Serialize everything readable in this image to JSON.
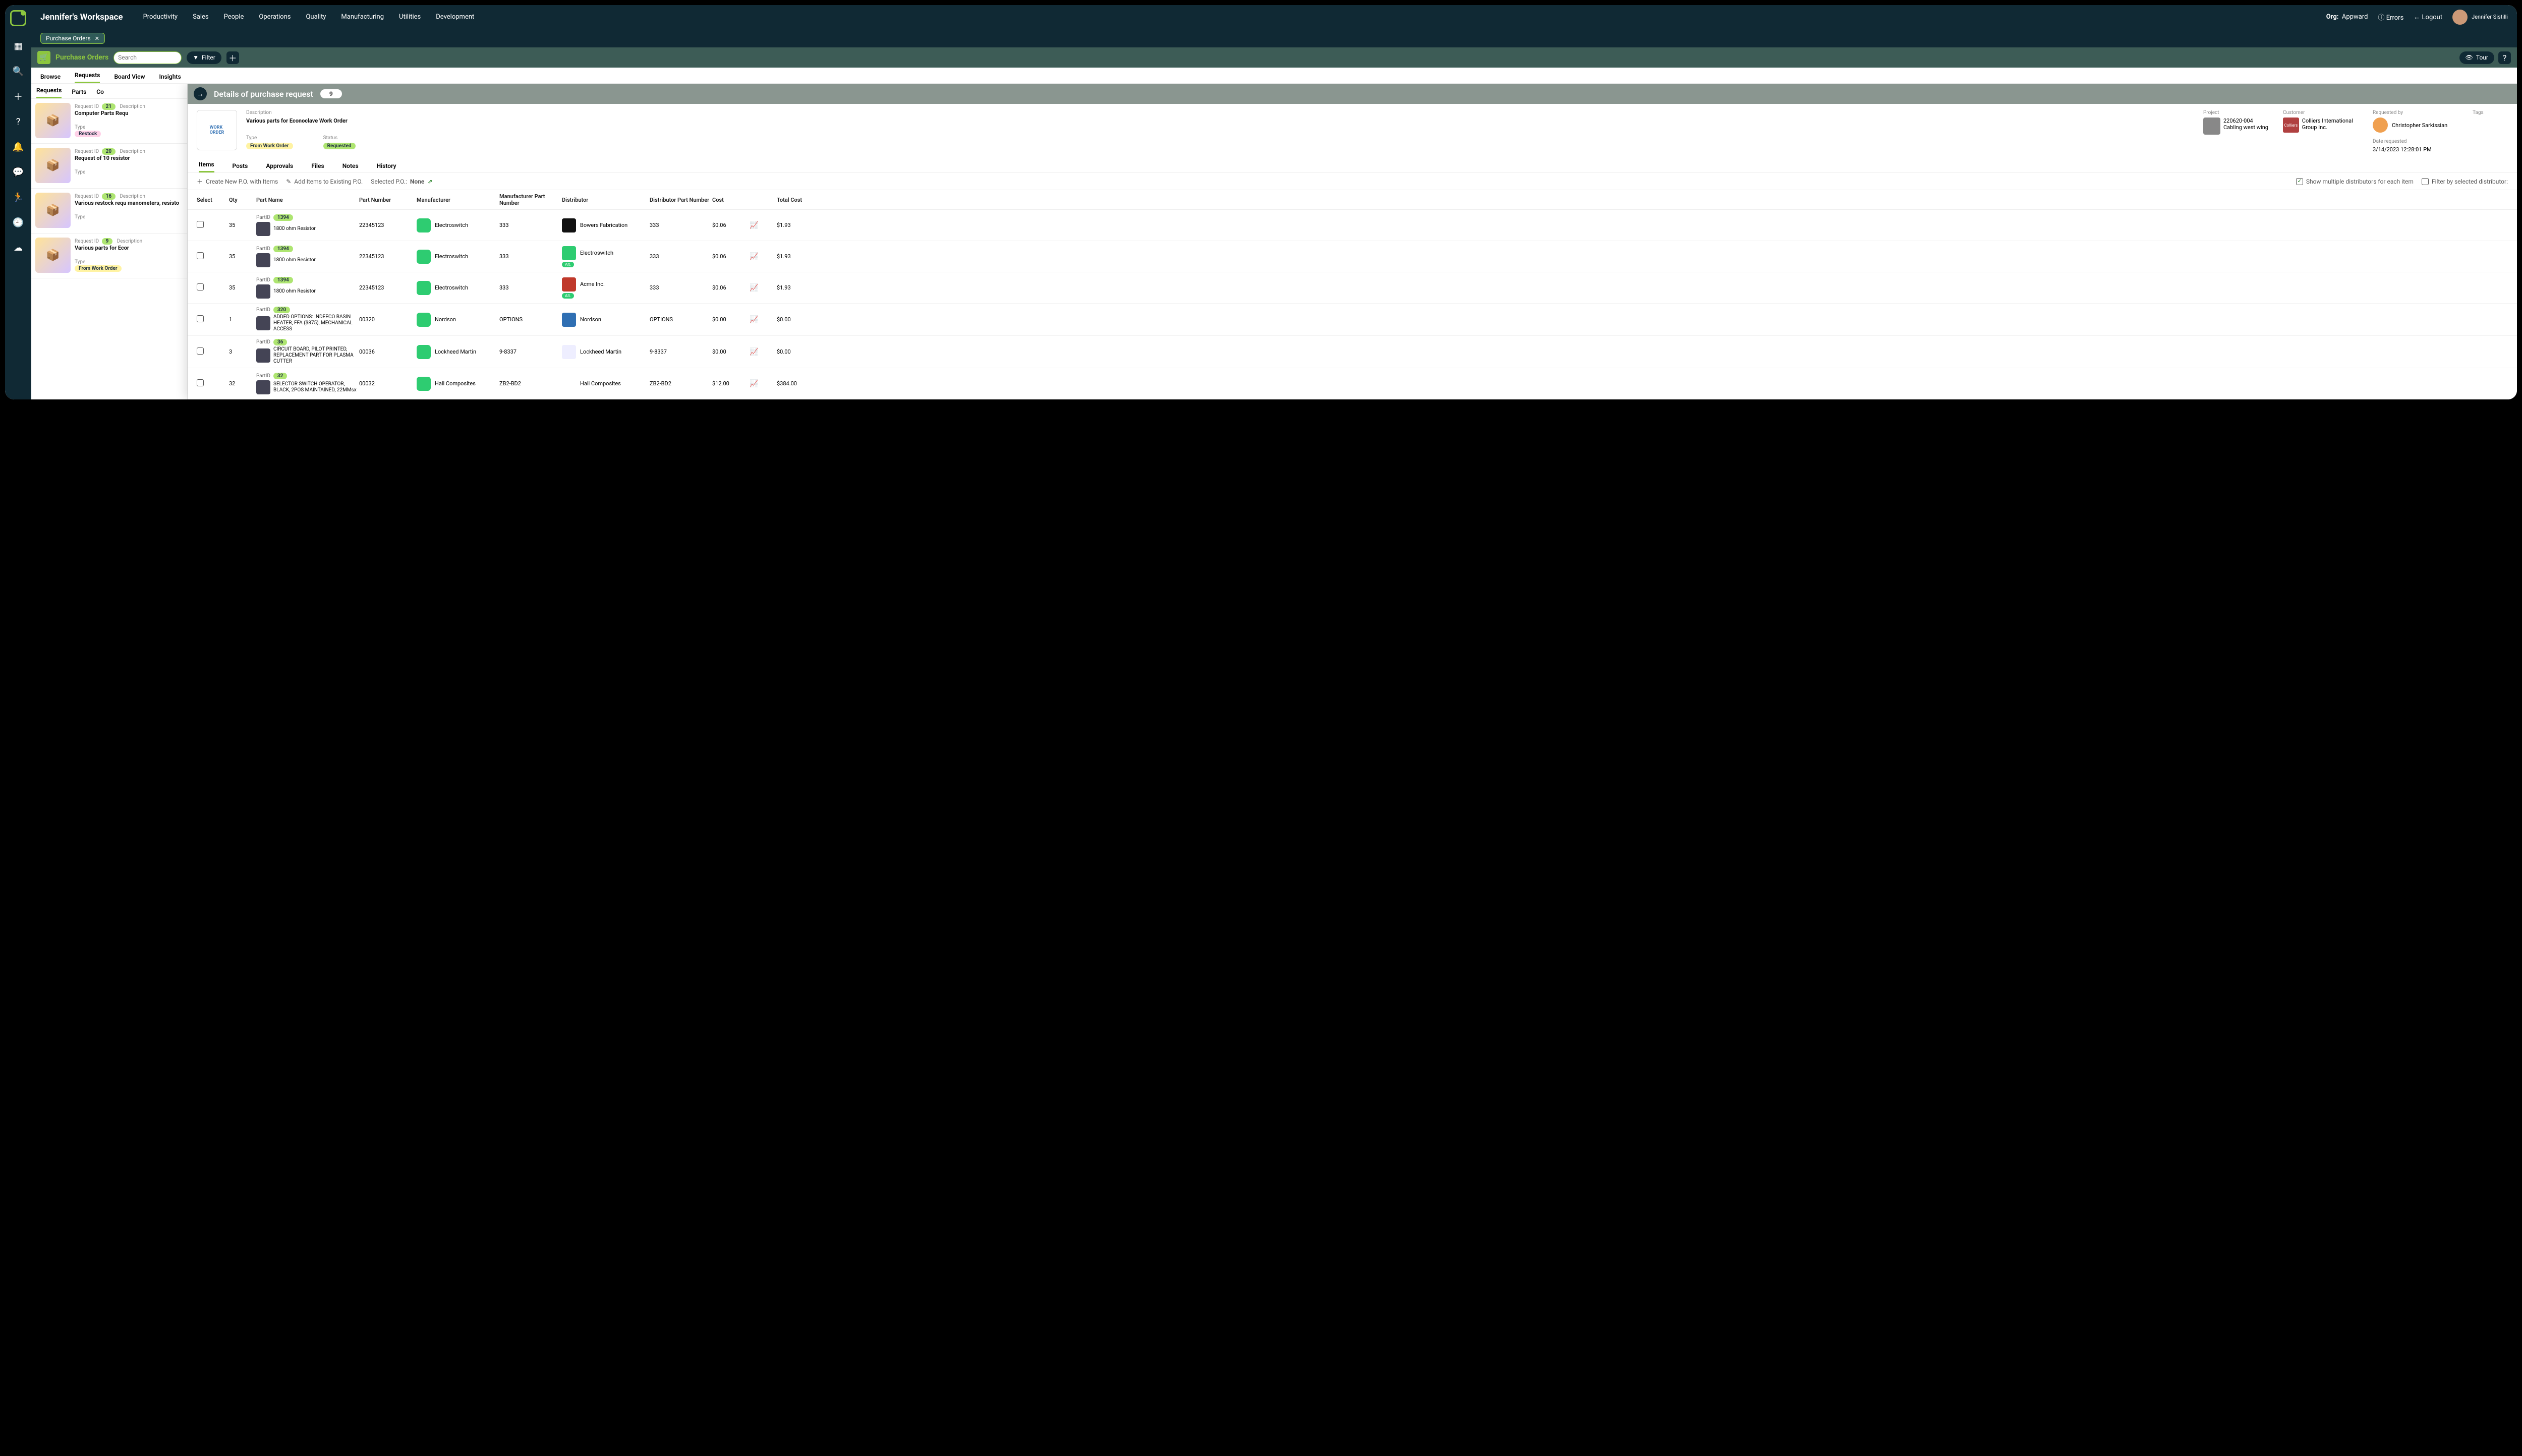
{
  "workspace": "Jennifer's Workspace",
  "nav": [
    "Productivity",
    "Sales",
    "People",
    "Operations",
    "Quality",
    "Manufacturing",
    "Utilities",
    "Development"
  ],
  "top": {
    "org_lbl": "Org:",
    "org": "Appward",
    "errors": "Errors",
    "logout": "Logout",
    "user": "Jennifer Sistilli"
  },
  "tab": {
    "label": "Purchase Orders"
  },
  "module": {
    "title": "Purchase Orders",
    "search_ph": "Search",
    "filter": "Filter",
    "tour": "Tour"
  },
  "subtabs": [
    "Browse",
    "Requests",
    "Board View",
    "Insights"
  ],
  "sidetabs": [
    "Requests",
    "Parts",
    "Co"
  ],
  "requests": [
    {
      "id": "21",
      "desc": "Computer Parts Requ",
      "type_badge": "Restock",
      "type_class": "pink"
    },
    {
      "id": "20",
      "desc": "Request of 10 resistor",
      "type_badge": "",
      "type_class": ""
    },
    {
      "id": "16",
      "desc": "Various restock requ manometers, resisto",
      "type_badge": "",
      "type_class": ""
    },
    {
      "id": "9",
      "desc": "Various parts for Ecor",
      "type_badge": "From Work Order",
      "type_class": "yellow"
    }
  ],
  "labels": {
    "reqid": "Request ID",
    "desc": "Description",
    "type": "Type"
  },
  "detail": {
    "title": "Details of purchase request",
    "id": "9",
    "desc_lbl": "Description",
    "desc": "Various parts for Econoclave Work Order",
    "type_lbl": "Type",
    "type": "From Work Order",
    "status_lbl": "Status",
    "status": "Requested",
    "project_lbl": "Project",
    "project_code": "220620-004",
    "project_name": "Cabling west wing",
    "customer_lbl": "Customer",
    "customer": "Colliers International Group Inc.",
    "reqby_lbl": "Requested by",
    "reqby": "Christopher Sarkissian",
    "tags_lbl": "Tags",
    "date_lbl": "Date requested",
    "date": "3/14/2023 12:28:01 PM"
  },
  "dtabs": [
    "Items",
    "Posts",
    "Approvals",
    "Files",
    "Notes",
    "History"
  ],
  "actions": {
    "create": "Create New P.O. with Items",
    "add": "Add Items to Existing P.O.",
    "selected": "Selected P.O.:",
    "none": "None",
    "showmulti": "Show multiple distributors for each item",
    "filterby": "Filter by selected distributor:"
  },
  "columns": [
    "Select",
    "Qty",
    "Part Name",
    "Part Number",
    "Manufacturer",
    "Manufacturer Part Number",
    "Distributor",
    "Distributor Part Number",
    "Cost",
    "",
    "Total Cost"
  ],
  "partid_lbl": "PartID",
  "rows": [
    {
      "qty": "35",
      "pid": "1394",
      "name": "1800 ohm Resistor",
      "pnum": "22345123",
      "mfr": "Electroswitch",
      "mpn": "333",
      "dist": "Bowers Fabrication",
      "dpn": "333",
      "cost": "$0.06",
      "total": "$1.93",
      "alt": false,
      "dcls": "bfs"
    },
    {
      "qty": "35",
      "pid": "1394",
      "name": "1800 ohm Resistor",
      "pnum": "22345123",
      "mfr": "Electroswitch",
      "mpn": "333",
      "dist": "Electroswitch",
      "dpn": "333",
      "cost": "$0.06",
      "total": "$1.93",
      "alt": true,
      "dcls": "green"
    },
    {
      "qty": "35",
      "pid": "1394",
      "name": "1800 ohm Resistor",
      "pnum": "22345123",
      "mfr": "Electroswitch",
      "mpn": "333",
      "dist": "Acme Inc.",
      "dpn": "333",
      "cost": "$0.06",
      "total": "$1.93",
      "alt": true,
      "dcls": "acme"
    },
    {
      "qty": "1",
      "pid": "320",
      "name": "ADDED OPTIONS: INDEECO BASIN HEATER, FFA ($875), MECHANICAL ACCESS",
      "pnum": "00320",
      "mfr": "Nordson",
      "mpn": "OPTIONS",
      "dist": "Nordson",
      "dpn": "OPTIONS",
      "cost": "$0.00",
      "total": "$0.00",
      "alt": false,
      "dcls": "nord"
    },
    {
      "qty": "3",
      "pid": "36",
      "name": "CIRCUIT BOARD, PILOT PRINTED, REPLACEMENT PART FOR PLASMA CUTTER",
      "pnum": "00036",
      "mfr": "Lockheed Martin",
      "mpn": "9-8337",
      "dist": "Lockheed Martin",
      "dpn": "9-8337",
      "cost": "$0.00",
      "total": "$0.00",
      "alt": false,
      "dcls": "lm"
    },
    {
      "qty": "32",
      "pid": "32",
      "name": "SELECTOR SWITCH OPERATOR, BLACK, 2POS MAINTAINED, 22MMsx",
      "pnum": "00032",
      "mfr": "Hall Composites",
      "mpn": "ZB2-BD2",
      "dist": "Hall Composites",
      "dpn": "ZB2-BD2",
      "cost": "$12.00",
      "total": "$384.00",
      "alt": false,
      "dcls": "hall"
    }
  ],
  "alt_label": "Alt."
}
